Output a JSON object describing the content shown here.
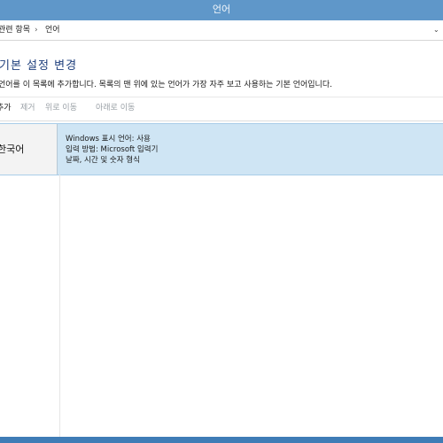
{
  "window": {
    "title": "언어"
  },
  "breadcrumb": {
    "item_1": "관련 항목",
    "separator": "›",
    "item_2": "언어",
    "dropdown_glyph": "⌄"
  },
  "main": {
    "title": "기본 설정 변경",
    "description": "언어를 이 목록에 추가합니다. 목록의 맨 위에 있는 언어가 가장 자주 보고 사용하는 기본 언어입니다."
  },
  "toolbar": {
    "add": "추가",
    "remove": "제거",
    "move_up": "위로 이동",
    "move_down": "아래로 이동"
  },
  "languages": [
    {
      "name": "한국어",
      "details": [
        "Windows 표시 언어: 사용",
        "입력 방법: Microsoft 입력기",
        "날짜, 시간 및 숫자 형식"
      ]
    }
  ],
  "colors": {
    "titlebar": "#5f97c9",
    "title_text": "#1e3f7c",
    "selected_row": "#cfe5f4",
    "bottom_bar": "#3f7cb6"
  }
}
